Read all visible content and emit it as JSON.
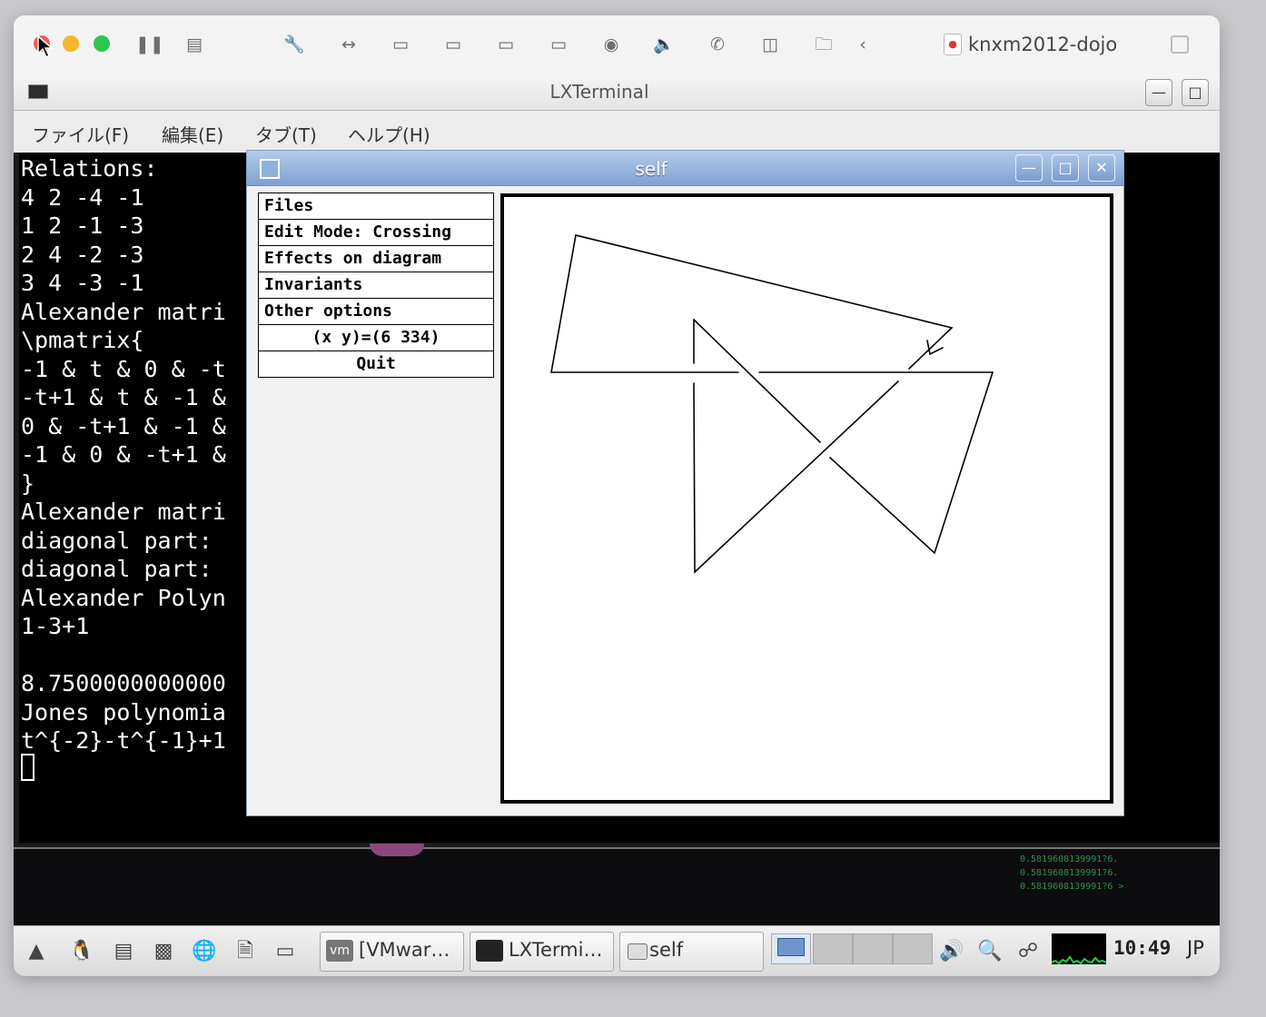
{
  "host": {
    "vm_name": "knxm2012-dojo",
    "traffic_colors": {
      "close": "#ee5d55",
      "minimize": "#f5b52c",
      "zoom": "#2cc74a"
    },
    "toolbar_icons": [
      "pause-icon",
      "snapshot-icon",
      "wrench-icon",
      "network-icon",
      "disk-icon",
      "disk-icon",
      "disk-icon",
      "disk-icon",
      "camera-icon",
      "sound-icon",
      "phone-icon",
      "floppy-icon",
      "folder-share-icon",
      "back-icon"
    ]
  },
  "lxterminal": {
    "title": "LXTerminal",
    "menu": [
      "ファイル(F)",
      "編集(E)",
      "タブ(T)",
      "ヘルプ(H)"
    ],
    "lines": [
      "Relations:",
      "4 2 -4 -1",
      "1 2 -1 -3",
      "2 4 -2 -3",
      "3 4 -3 -1",
      "Alexander matri",
      "\\pmatrix{",
      "-1 & t & 0 & -t",
      "-t+1 & t & -1 &",
      "0 & -t+1 & -1 &",
      "-1 & 0 & -t+1 &",
      "}",
      "Alexander matri",
      "diagonal part:",
      "diagonal part:",
      "Alexander Polyn",
      "1-3+1",
      "",
      "8.7500000000000",
      "Jones polynomia",
      "t^{-2}-t^{-1}+1"
    ]
  },
  "self_window": {
    "title": "self",
    "menu": {
      "files": "Files",
      "edit_mode": "Edit Mode: Crossing",
      "effects": "Effects on diagram",
      "invariants": "Invariants",
      "other": "Other options",
      "coords": "(x y)=(6 334)",
      "quit": "Quit"
    }
  },
  "background": {
    "numbers": "0.5819608139991?6.\n0.5819608139991?6.\n0.5819608139991?6 >"
  },
  "taskbar": {
    "tasks": [
      {
        "label": "[VMwar…",
        "icon": "vmware-icon"
      },
      {
        "label": "LXTermi…",
        "icon": "terminal-icon"
      },
      {
        "label": "self",
        "icon": "window-icon"
      }
    ],
    "clock": "10:49",
    "lang": "JP"
  }
}
